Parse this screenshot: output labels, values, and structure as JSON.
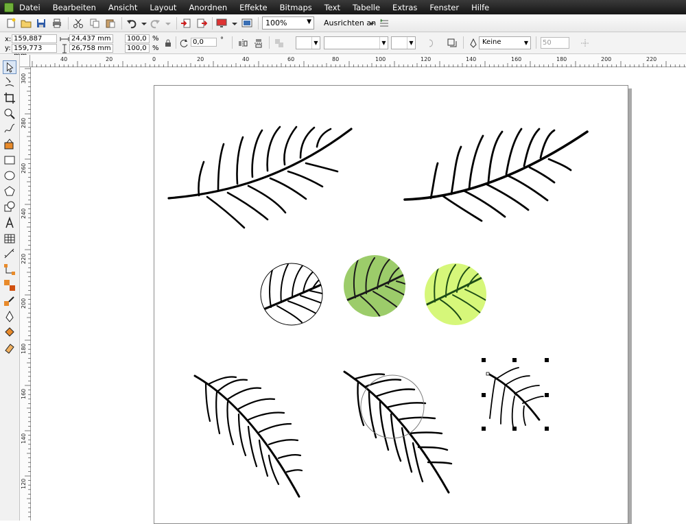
{
  "menu": [
    "Datei",
    "Bearbeiten",
    "Ansicht",
    "Layout",
    "Anordnen",
    "Effekte",
    "Bitmaps",
    "Text",
    "Tabelle",
    "Extras",
    "Fenster",
    "Hilfe"
  ],
  "toolbar": {
    "zoom": "100%",
    "snap_label": "Ausrichten an"
  },
  "propbar": {
    "x_label": "x:",
    "y_label": "y:",
    "x_value": "159,887 mm",
    "y_value": "159,773 mm",
    "width_value": "24,437 mm",
    "height_value": "26,758 mm",
    "scale_x": "100,0",
    "scale_y": "100,0",
    "percent": "%",
    "rotation": "0,0",
    "degree": "°",
    "outline": "Keine",
    "opacity": "50"
  },
  "ruler_h": [
    "40",
    "20",
    "0",
    "20",
    "40",
    "60",
    "80",
    "100",
    "120",
    "140",
    "160",
    "180",
    "200",
    "220"
  ],
  "ruler_v": [
    "300",
    "280",
    "260",
    "240",
    "220",
    "200",
    "180",
    "160",
    "140",
    "120"
  ],
  "colors": {
    "leaf_green": "#9ccc6a",
    "light_green": "#d6f77a",
    "dark_vein": "#1e4d16"
  }
}
